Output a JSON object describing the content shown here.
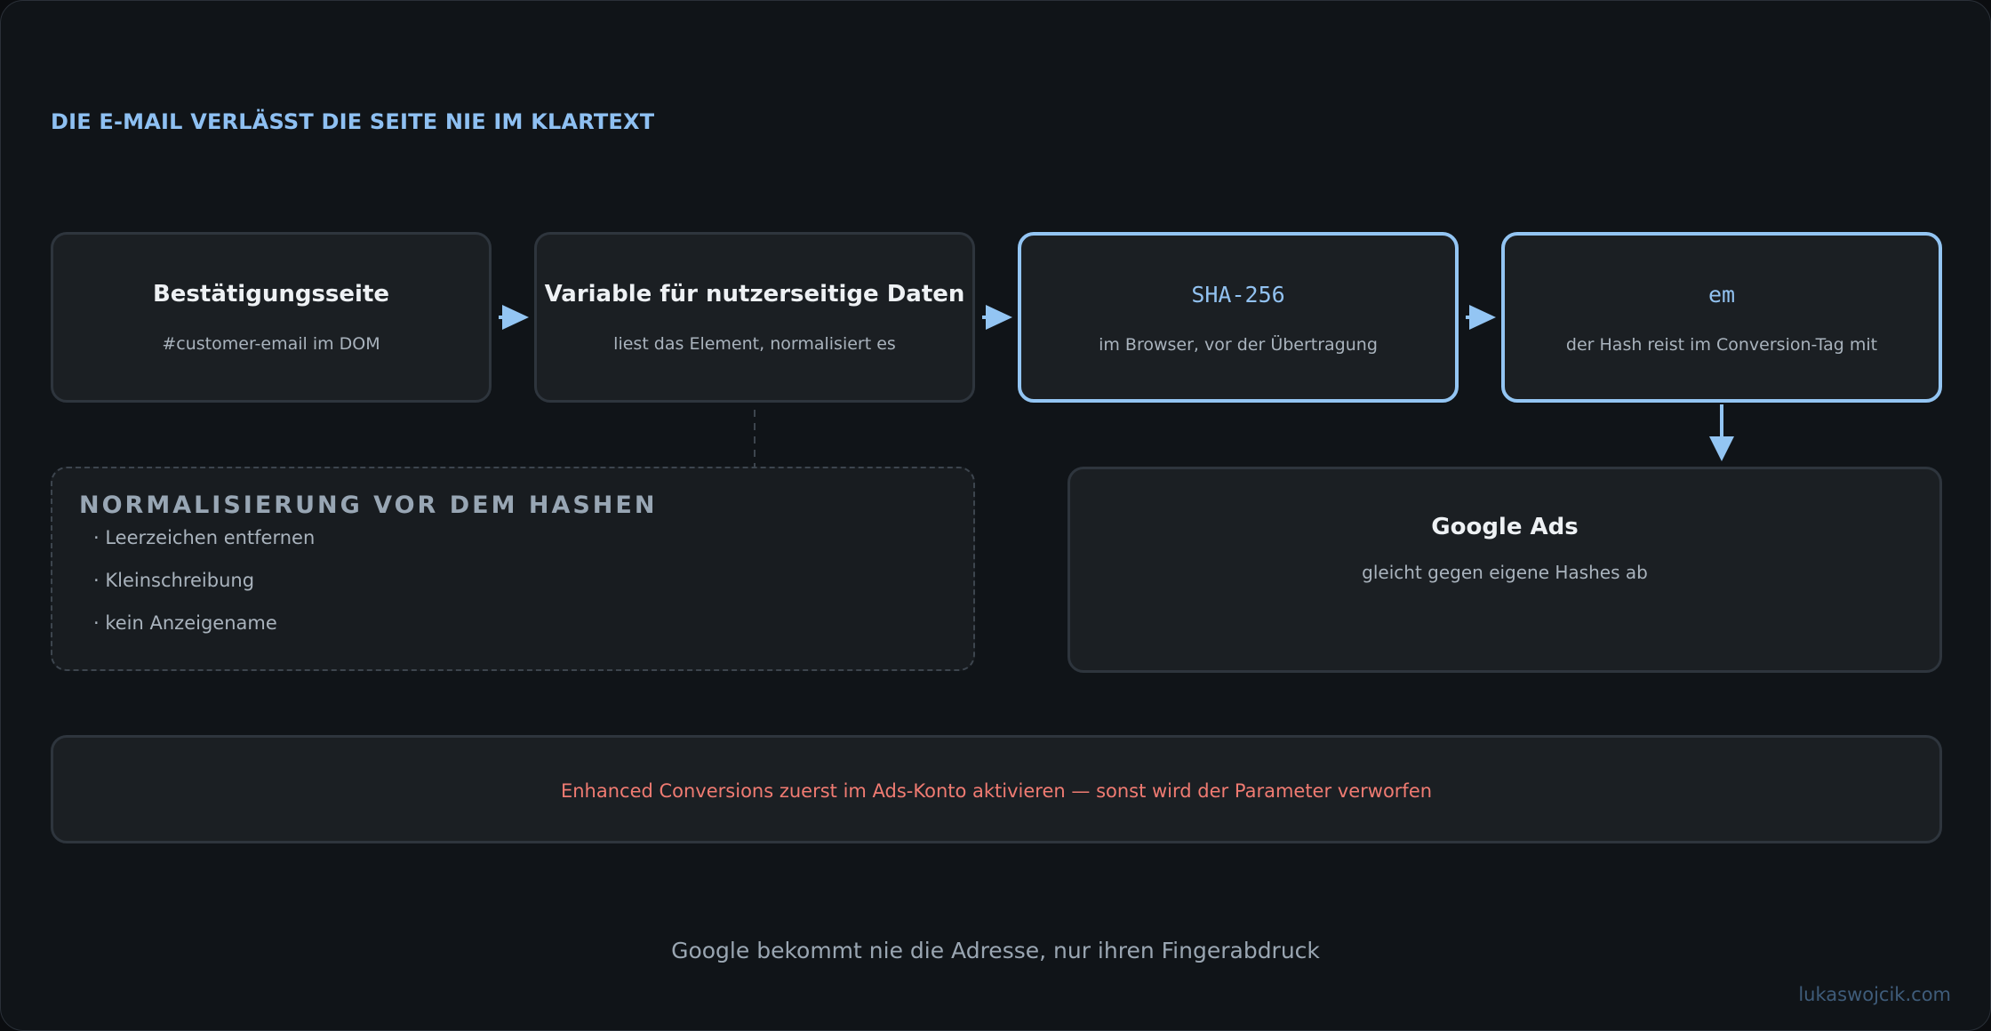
{
  "title": "DIE E-MAIL VERLÄSST DIE SEITE NIE IM KLARTEXT",
  "steps": [
    {
      "title": "Bestätigungsseite",
      "subtitle": "#customer-email im DOM"
    },
    {
      "title": "Variable für nutzerseitige Daten",
      "subtitle": "liest das Element, normalisiert es"
    },
    {
      "title": "SHA-256",
      "subtitle": "im Browser, vor der Übertragung"
    },
    {
      "title": "em",
      "subtitle": "der Hash reist im Conversion-Tag mit"
    }
  ],
  "normalization": {
    "heading": "NORMALISIERUNG VOR DEM HASHEN",
    "items": [
      "· Leerzeichen entfernen",
      "· Kleinschreibung",
      "· kein Anzeigename"
    ]
  },
  "destination": {
    "title": "Google Ads",
    "subtitle": "gleicht gegen eigene Hashes ab"
  },
  "warning": "Enhanced Conversions zuerst im Ads-Konto aktivieren — sonst wird der Parameter verworfen",
  "footer": "Google bekommt nie die Adresse, nur ihren Fingerabdruck",
  "credit": "lukaswojcik.com",
  "colors": {
    "accent": "#93c5f3",
    "warning": "#f07b72",
    "background": "#101418",
    "box": "#1b1f23"
  }
}
